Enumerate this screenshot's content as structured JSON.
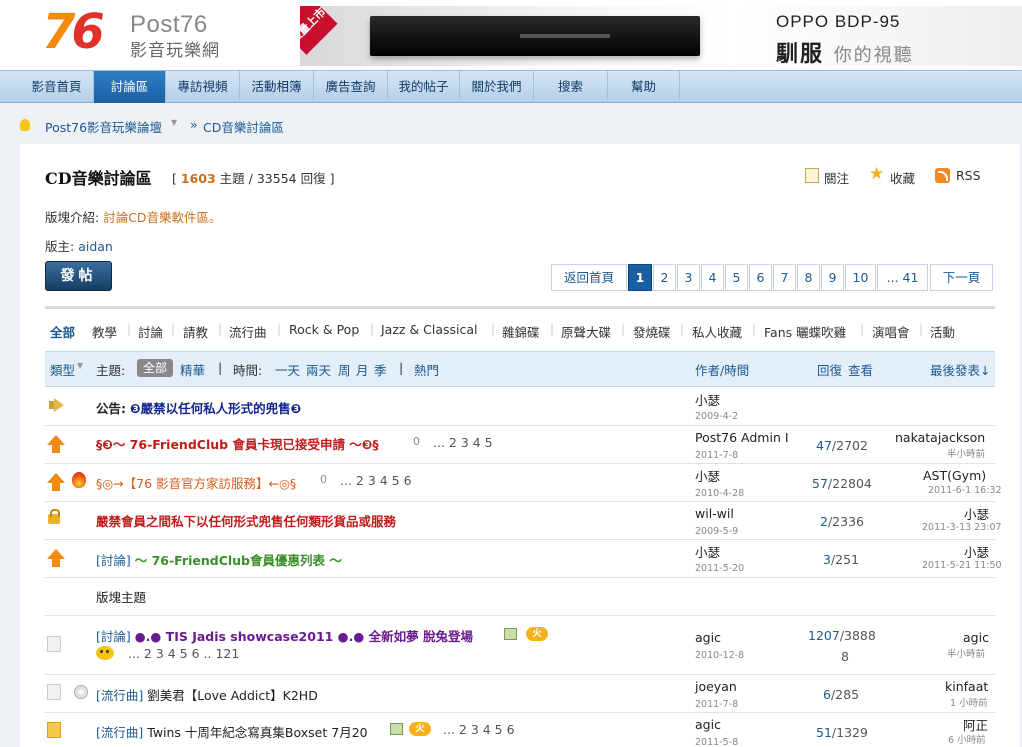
{
  "header": {
    "logo_num_7": "7",
    "logo_num_6": "6",
    "logo_en": "Post76",
    "logo_cn": "影音玩樂網",
    "banner_badge": "限量上市",
    "banner_title": "OPPO BDP-95",
    "banner_slogan_big": "馴服",
    "banner_slogan_small": "你的視聽"
  },
  "nav": [
    {
      "label": "影音首頁"
    },
    {
      "label": "討論區"
    },
    {
      "label": "專訪視頻"
    },
    {
      "label": "活動相簿"
    },
    {
      "label": "廣告查詢"
    },
    {
      "label": "我的帖子"
    },
    {
      "label": "關於我們"
    },
    {
      "label": "搜索"
    },
    {
      "label": "幫助"
    }
  ],
  "breadcrumb": {
    "forum": "Post76影音玩樂論壇",
    "sep": "»",
    "current": "CD音樂討論區"
  },
  "forum": {
    "title": "CD音樂討論區",
    "stats_open": "[",
    "topics": "1603",
    "topics_label": "主題",
    "slash": "/",
    "replies": "33554",
    "replies_label": "回復",
    "stats_close": "]",
    "follow": "關注",
    "favorite": "收藏",
    "rss": "RSS",
    "intro_label": "版塊介紹:",
    "intro_text": "討論CD音樂軟件區。",
    "moderator_label": "版主:",
    "moderator_name": "aidan",
    "post_button": "發帖"
  },
  "pager": {
    "back": "返回首頁",
    "pages": [
      "1",
      "2",
      "3",
      "4",
      "5",
      "6",
      "7",
      "8",
      "9",
      "10"
    ],
    "last": "... 41",
    "next": "下一頁"
  },
  "types": [
    "全部",
    "教學",
    "討論",
    "請教",
    "流行曲",
    "Rock & Pop",
    "Jazz & Classical",
    "雜錦碟",
    "原聲大碟",
    "發燒碟",
    "私人收藏",
    "Fans 曬蝶吹雞",
    "演唱會",
    "活動"
  ],
  "thead": {
    "type": "類型",
    "subject_label": "主題:",
    "all": "全部",
    "digest": "精華",
    "bar1": "|",
    "time_label": "時間:",
    "t1": "一天",
    "t2": "兩天",
    "t3": "周",
    "t4": "月",
    "t5": "季",
    "bar2": "|",
    "hot": "熱門",
    "author_time": "作者/時間",
    "replies": "回復",
    "views": "查看",
    "last_post": "最後發表↓"
  },
  "rows": [
    {
      "prefix": "公告:",
      "title": "❸嚴禁以任何私人形式的兜售❸",
      "author": "小瑟",
      "date": "2009-4-2"
    },
    {
      "title": "§❸～ 76-FriendClub 會員卡現已接受申請 ～❸§",
      "pages": "... 2 3 4 5",
      "author": "Post76 Admin I",
      "date": "2011-7-8",
      "replies": "47",
      "views": "2702",
      "last_user": "nakatajackson",
      "last_time": "半小時前"
    },
    {
      "title": "§◎→【76 影音官方家訪服務】←◎§",
      "pages": "... 2 3 4 5 6",
      "author": "小瑟",
      "date": "2010-4-28",
      "replies": "57",
      "views": "22804",
      "last_user": "AST(Gym)",
      "last_time": "2011-6-1 16:32"
    },
    {
      "title": "嚴禁會員之間私下以任何形式兜售任何類形貨品或服務",
      "author": "wil-wil",
      "date": "2009-5-9",
      "replies": "2",
      "views": "2336",
      "last_user": "小瑟",
      "last_time": "2011-3-13 23:07"
    },
    {
      "type": "[討論]",
      "title": "～ 76-FriendClub會員優惠列表 ～",
      "author": "小瑟",
      "date": "2011-5-20",
      "replies": "3",
      "views": "251",
      "last_user": "小瑟",
      "last_time": "2011-5-21 11:50"
    },
    {
      "section": "版塊主題"
    },
    {
      "type": "[討論]",
      "title": "●.● TIS Jadis showcase2011 ●.● 全新如夢  脫兔登場",
      "hot": "火",
      "pages": "... 2 3 4 5 6 .. 121",
      "author": "agic",
      "date": "2010-12-8",
      "replies": "1207",
      "views_line1": "3888",
      "views_line2": "8",
      "last_user": "agic",
      "last_time": "半小時前"
    },
    {
      "type": "[流行曲]",
      "title": "劉美君【Love Addict】K2HD",
      "author": "joeyan",
      "date": "2011-7-8",
      "replies": "6",
      "views": "285",
      "last_user": "kinfaat",
      "last_time": "1 小時前"
    },
    {
      "type": "[流行曲]",
      "title": "Twins 十周年紀念寫真集Boxset 7月20",
      "hot": "火",
      "pages": "... 2 3 4 5 6",
      "author": "agic",
      "date": "2011-5-8",
      "replies": "51",
      "views": "1329",
      "last_user": "阿正",
      "last_time": "6 小時前"
    }
  ]
}
